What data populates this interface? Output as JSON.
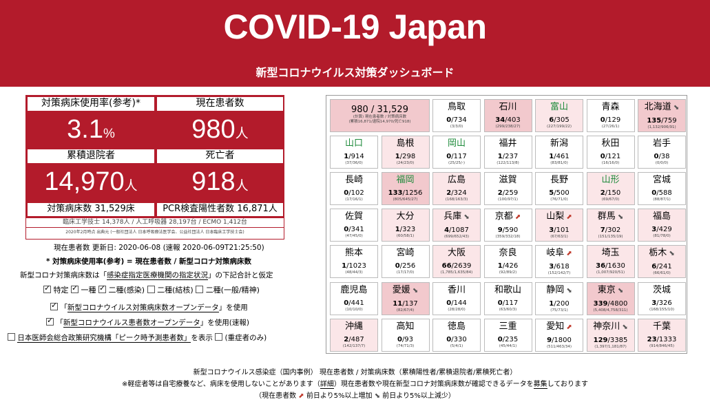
{
  "header": {
    "title": "COVID-19 Japan",
    "subtitle": "新型コロナウイルス対策ダッシュボード"
  },
  "stats": {
    "bed_usage": {
      "label": "対策病床使用率(参考)*",
      "value": "3.1",
      "unit": "%"
    },
    "current_patients": {
      "label": "現在患者数",
      "value": "980",
      "unit": "人"
    },
    "discharged": {
      "label": "累積退院者",
      "value": "14,970",
      "unit": "人"
    },
    "deaths": {
      "label": "死亡者",
      "value": "918",
      "unit": "人"
    },
    "beds": "対策病床数 31,529床",
    "pcr": "PCR検査陽性者数 16,871人",
    "equipment_note": "臨床工学技士 14,378人 / 人工呼吸器 28,197台 / ECMO 1,412台",
    "source_note": "2020年2月時点 出典元 (一般社団法人 日本呼吸療法医学会、公益社団法人 日本臨床工学技士会)"
  },
  "updated": "現在患者数 更新日: 2020-06-08 (速報 2020-06-09T21:25:50)",
  "formula": "* 対策病床使用率(参考) = 現在患者数 / 新型コロナ対策病床数",
  "beds_source": {
    "pre": "新型コロナ対策病床数は「",
    "link": "感染症指定医療機関の指定状況",
    "post": "」の下記合計と仮定"
  },
  "bed_types": [
    "特定",
    "一種",
    "二種(感染)",
    "二種(結核)",
    "二種(一般/精神)"
  ],
  "opt1": {
    "pre": "「",
    "link": "新型コロナウイルス対策病床数オープンデータ",
    "post": "」を使用"
  },
  "opt2": {
    "pre": "「",
    "link": "新型コロナウイルス患者数オープンデータ",
    "post": "」を使用(速報)"
  },
  "opt3": {
    "link": "日本医師会総合政策研究機構「ピーク時予測患者数」",
    "post": "を表示",
    "extra": "(重症者のみ)"
  },
  "total": {
    "big": "980 / 31,529",
    "l1": "(計算) 現在患者数 / 対策病床数",
    "l2": "(累積16,871/退院14,970/死亡918)"
  },
  "prefectures": [
    {
      "name": "鳥取",
      "count": "0",
      "beds": "/734",
      "sub": "(3/3/0)",
      "level": 0
    },
    {
      "name": "石川",
      "count": "34",
      "beds": "/403",
      "sub": "(299/238/27)",
      "level": 2
    },
    {
      "name": "富山",
      "count": "6",
      "beds": "/305",
      "sub": "(227/199/22)",
      "level": 1,
      "green": true
    },
    {
      "name": "青森",
      "count": "0",
      "beds": "/129",
      "sub": "(27/26/1)",
      "level": 0
    },
    {
      "name": "北海道",
      "count": "135",
      "beds": "/759",
      "sub": "(1,132/906/91)",
      "level": 2,
      "arrow": "dn"
    },
    {
      "name": "山口",
      "count": "1",
      "beds": "/914",
      "sub": "(37/36/0)",
      "level": 0,
      "green": true
    },
    {
      "name": "島根",
      "count": "1",
      "beds": "/298",
      "sub": "(24/23/0)",
      "level": 1
    },
    {
      "name": "岡山",
      "count": "0",
      "beds": "/117",
      "sub": "(25/25/-)",
      "level": 0,
      "green": true
    },
    {
      "name": "福井",
      "count": "1",
      "beds": "/237",
      "sub": "(122/113/8)",
      "level": 0
    },
    {
      "name": "新潟",
      "count": "1",
      "beds": "/461",
      "sub": "(83/81/0)",
      "level": 0
    },
    {
      "name": "秋田",
      "count": "0",
      "beds": "/121",
      "sub": "(16/16/0)",
      "level": 0
    },
    {
      "name": "岩手",
      "count": "0",
      "beds": "/38",
      "sub": "(0/0/0)",
      "level": 0
    },
    {
      "name": "長崎",
      "count": "0",
      "beds": "/102",
      "sub": "(17/16/1)",
      "level": 0
    },
    {
      "name": "福岡",
      "count": "133",
      "beds": "/1256",
      "sub": "(805/645/27)",
      "level": 2,
      "green": true
    },
    {
      "name": "広島",
      "count": "2",
      "beds": "/324",
      "sub": "(168/163/3)",
      "level": 1
    },
    {
      "name": "滋賀",
      "count": "2",
      "beds": "/259",
      "sub": "(100/97/1)",
      "level": 0
    },
    {
      "name": "長野",
      "count": "5",
      "beds": "/500",
      "sub": "(76/71/0)",
      "level": 0
    },
    {
      "name": "山形",
      "count": "2",
      "beds": "/150",
      "sub": "(69/67/0)",
      "level": 1,
      "green": true
    },
    {
      "name": "宮城",
      "count": "0",
      "beds": "/588",
      "sub": "(88/87/1)",
      "level": 0
    },
    {
      "name": "佐賀",
      "count": "0",
      "beds": "/341",
      "sub": "(47/45/0)",
      "level": 0
    },
    {
      "name": "大分",
      "count": "1",
      "beds": "/323",
      "sub": "(60/58/1)",
      "level": 1
    },
    {
      "name": "兵庫",
      "count": "4",
      "beds": "/1087",
      "sub": "(699/652/43)",
      "level": 1,
      "arrow": "dn"
    },
    {
      "name": "京都",
      "count": "9",
      "beds": "/590",
      "sub": "(359/332/18)",
      "level": 0,
      "arrow": "up"
    },
    {
      "name": "山梨",
      "count": "3",
      "beds": "/101",
      "sub": "(67/63/1)",
      "level": 1,
      "arrow": "up"
    },
    {
      "name": "群馬",
      "count": "7",
      "beds": "/302",
      "sub": "(151/135/19)",
      "level": 1,
      "arrow": "dn"
    },
    {
      "name": "福島",
      "count": "3",
      "beds": "/429",
      "sub": "(81/78/0)",
      "level": 1
    },
    {
      "name": "熊本",
      "count": "1",
      "beds": "/1023",
      "sub": "(48/44/3)",
      "level": 0
    },
    {
      "name": "宮崎",
      "count": "0",
      "beds": "/256",
      "sub": "(17/17/0)",
      "level": 0
    },
    {
      "name": "大阪",
      "count": "66",
      "beds": "/2639",
      "sub": "(1,785/1,635/84)",
      "level": 1
    },
    {
      "name": "奈良",
      "count": "1",
      "beds": "/426",
      "sub": "(92/89/2)",
      "level": 0
    },
    {
      "name": "岐阜",
      "count": "3",
      "beds": "/618",
      "sub": "(152/142/7)",
      "level": 0,
      "arrow": "up"
    },
    {
      "name": "埼玉",
      "count": "36",
      "beds": "/1630",
      "sub": "(1,007/920/51)",
      "level": 1
    },
    {
      "name": "栃木",
      "count": "6",
      "beds": "/241",
      "sub": "(66/61/0)",
      "level": 1,
      "arrow": "dn"
    },
    {
      "name": "鹿児島",
      "count": "0",
      "beds": "/441",
      "sub": "(10/10/0)",
      "level": 0
    },
    {
      "name": "愛媛",
      "count": "11",
      "beds": "/137",
      "sub": "(82/67/4)",
      "level": 2,
      "arrow": "dn"
    },
    {
      "name": "香川",
      "count": "0",
      "beds": "/144",
      "sub": "(28/28/0)",
      "level": 0
    },
    {
      "name": "和歌山",
      "count": "0",
      "beds": "/117",
      "sub": "(63/60/3)",
      "level": 0
    },
    {
      "name": "静岡",
      "count": "1",
      "beds": "/200",
      "sub": "(75/73/1)",
      "level": 0,
      "arrow": "dn"
    },
    {
      "name": "東京",
      "count": "339",
      "beds": "/4800",
      "sub": "(5,408/4,758/311)",
      "level": 2,
      "arrow": "dn"
    },
    {
      "name": "茨城",
      "count": "3",
      "beds": "/326",
      "sub": "(168/155/10)",
      "level": 0
    },
    {
      "name": "沖縄",
      "count": "2",
      "beds": "/487",
      "sub": "(142/137/7)",
      "level": 1
    },
    {
      "name": "高知",
      "count": "0",
      "beds": "/93",
      "sub": "(74/71/3)",
      "level": 0
    },
    {
      "name": "徳島",
      "count": "0",
      "beds": "/330",
      "sub": "(5/4/1)",
      "level": 0
    },
    {
      "name": "三重",
      "count": "0",
      "beds": "/235",
      "sub": "(45/44/1)",
      "level": 0
    },
    {
      "name": "愛知",
      "count": "9",
      "beds": "/1800",
      "sub": "(511/463/34)",
      "level": 0,
      "arrow": "up"
    },
    {
      "name": "神奈川",
      "count": "129",
      "beds": "/3385",
      "sub": "(1,397/1,181/87)",
      "level": 1,
      "arrow": "dn"
    },
    {
      "name": "千葉",
      "count": "23",
      "beds": "/1333",
      "sub": "(914/846/45)",
      "level": 1
    }
  ],
  "footer": {
    "line1": "新型コロナウイルス感染症（国内事例） 現在患者数 / 対策病床数（累積陽性者/累積退院者/累積死亡者）",
    "line2a": "※軽症者等は自宅療養など、病床を使用しないことがあります（",
    "line2link": "詳細",
    "line2b": "）現在患者数や現在新型コロナ対策病床数が確認できるデータを",
    "line2link2": "募集",
    "line2c": "しております",
    "line3a": "（現在患者数 ",
    "line3b": " 前日より5%以上増加 ",
    "line3c": " 前日より5%以上減少）"
  }
}
